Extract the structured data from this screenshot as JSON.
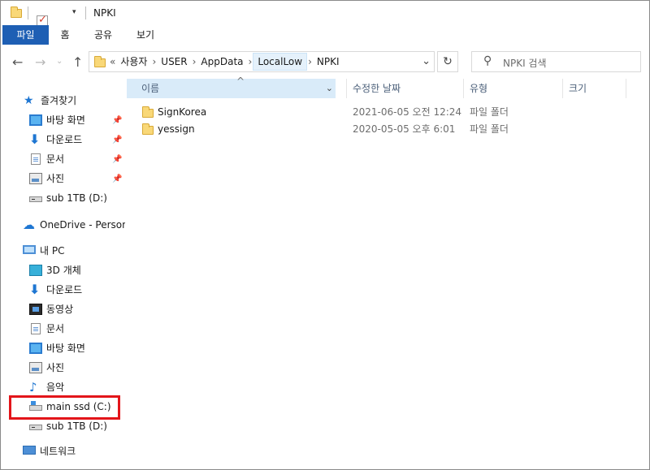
{
  "window": {
    "title": "NPKI"
  },
  "ribbon": {
    "tabs": [
      "파일",
      "홈",
      "공유",
      "보기"
    ]
  },
  "address": {
    "overflow": "«",
    "crumbs": [
      "사용자",
      "USER",
      "AppData",
      "LocalLow",
      "NPKI"
    ],
    "highlighted_crumb": "LocalLow"
  },
  "search": {
    "placeholder": "NPKI 검색"
  },
  "sidebar": {
    "quick_access": {
      "label": "즐겨찾기",
      "items": [
        {
          "label": "바탕 화면",
          "icon": "desktop-icon",
          "pinned": true
        },
        {
          "label": "다운로드",
          "icon": "download-icon",
          "pinned": true
        },
        {
          "label": "문서",
          "icon": "document-icon",
          "pinned": true
        },
        {
          "label": "사진",
          "icon": "picture-icon",
          "pinned": true
        },
        {
          "label": "sub 1TB (D:)",
          "icon": "drive-icon",
          "pinned": false
        }
      ]
    },
    "onedrive": {
      "label": "OneDrive - Persona"
    },
    "this_pc": {
      "label": "내 PC",
      "items": [
        {
          "label": "3D 개체",
          "icon": "3d-objects-icon"
        },
        {
          "label": "다운로드",
          "icon": "download-icon"
        },
        {
          "label": "동영상",
          "icon": "video-icon"
        },
        {
          "label": "문서",
          "icon": "document-icon"
        },
        {
          "label": "바탕 화면",
          "icon": "desktop-icon"
        },
        {
          "label": "사진",
          "icon": "picture-icon"
        },
        {
          "label": "음악",
          "icon": "music-icon"
        },
        {
          "label": "main ssd (C:)",
          "icon": "system-drive-icon",
          "highlighted": true
        },
        {
          "label": "sub 1TB (D:)",
          "icon": "drive-icon"
        }
      ]
    },
    "network": {
      "label": "네트워크"
    }
  },
  "file_list": {
    "columns": [
      "이름",
      "수정한 날짜",
      "유형",
      "크기"
    ],
    "sorted_column": "이름",
    "rows": [
      {
        "name": "SignKorea",
        "modified": "2021-06-05 오전 12:24",
        "type": "파일 폴더",
        "size": ""
      },
      {
        "name": "yessign",
        "modified": "2020-05-05 오후 6:01",
        "type": "파일 폴더",
        "size": ""
      }
    ]
  },
  "colors": {
    "file_tab": "#1e5fb4",
    "highlight_box": "#e3151a",
    "sorted_header": "#d9ebf9"
  }
}
